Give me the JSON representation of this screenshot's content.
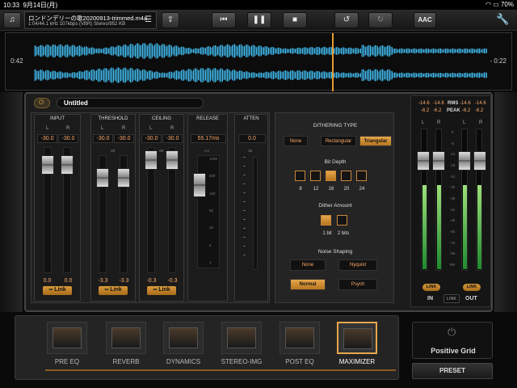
{
  "status": {
    "time": "10:33",
    "date": "9月14日(月)",
    "battery": "70%"
  },
  "toolbar": {
    "filename": "ロンドンデリーの歌20200913-trimmed.m4a",
    "fileinfo": "1:04/44.1 kHz 107kbps (VBR) Stereo/952 KB",
    "format_label": "AAC"
  },
  "waveform": {
    "time_elapsed": "0:42",
    "time_remaining": "- 0:22"
  },
  "preset": {
    "name": "Untitled"
  },
  "input": {
    "title": "INPUT",
    "l_label": "L",
    "r_label": "R",
    "l_value": "-30.0",
    "r_value": "-30.0",
    "l_out": "0.0",
    "r_out": "0.0",
    "link_label": "Link"
  },
  "threshold": {
    "title": "THRESHOLD",
    "l_label": "L",
    "r_label": "R",
    "l_value": "-30.0",
    "r_value": "-30.0",
    "l_out": "-3.3",
    "r_out": "-3.3",
    "link_label": "Link",
    "scale_top": "dB"
  },
  "ceiling": {
    "title": "CEILING",
    "l_label": "L",
    "r_label": "R",
    "l_value": "-30.0",
    "r_value": "-30.0",
    "l_out": "-0.3",
    "r_out": "-0.3",
    "link_label": "Link",
    "scale_top": "dB"
  },
  "release": {
    "title": "RELEASE",
    "value": "55.17ms",
    "scale_top": "ms",
    "scale": [
      "1000",
      "500",
      "100",
      "50",
      "10",
      "5",
      "1"
    ]
  },
  "atten": {
    "title": "ATTEN",
    "value": "0.0",
    "scale_top": "dB"
  },
  "dither": {
    "type_title": "DITHERING TYPE",
    "types": [
      "None",
      "Rectangular",
      "Triangular"
    ],
    "type_selected": 2,
    "depth_title": "Bit Depth",
    "depths": [
      "8",
      "12",
      "16",
      "20",
      "24"
    ],
    "depth_selected": 2,
    "amount_title": "Dither Amount",
    "amounts": [
      "1 bit",
      "2 bits"
    ],
    "amount_selected": 0,
    "shaping_title": "Noise Shaping",
    "shaping": [
      "None",
      "Nyquist",
      "Normal",
      "Psych"
    ],
    "shaping_selected": 2
  },
  "meters": {
    "in_rms_l": "-14.6",
    "in_rms_r": "-14.6",
    "rms_label": "RMS",
    "out_rms_l": "-14.6",
    "out_rms_r": "-14.6",
    "in_peak_l": "-6.2",
    "in_peak_r": "-6.2",
    "peak_label": "PEAK",
    "out_peak_l": "-6.2",
    "out_peak_r": "-6.2",
    "l_label": "L",
    "r_label": "R",
    "scale": [
      "0",
      "-6",
      "-12",
      "-18",
      "-24",
      "-30",
      "-36",
      "-42",
      "-48",
      "-60",
      "-72",
      "-96",
      "INF"
    ],
    "link_label": "LINK",
    "in_label": "IN",
    "out_label": "OUT"
  },
  "modules": [
    "PRE EQ",
    "REVERB",
    "DYNAMICS",
    "STEREO-IMG",
    "POST EQ",
    "MAXIMIZER"
  ],
  "module_selected": 5,
  "brand": "Positive Grid",
  "preset_button": "PRESET",
  "colors": {
    "accent": "#e6a64b",
    "value": "#ffab6b",
    "wave": "#3fb6e8",
    "playhead": "#e69a2e"
  }
}
